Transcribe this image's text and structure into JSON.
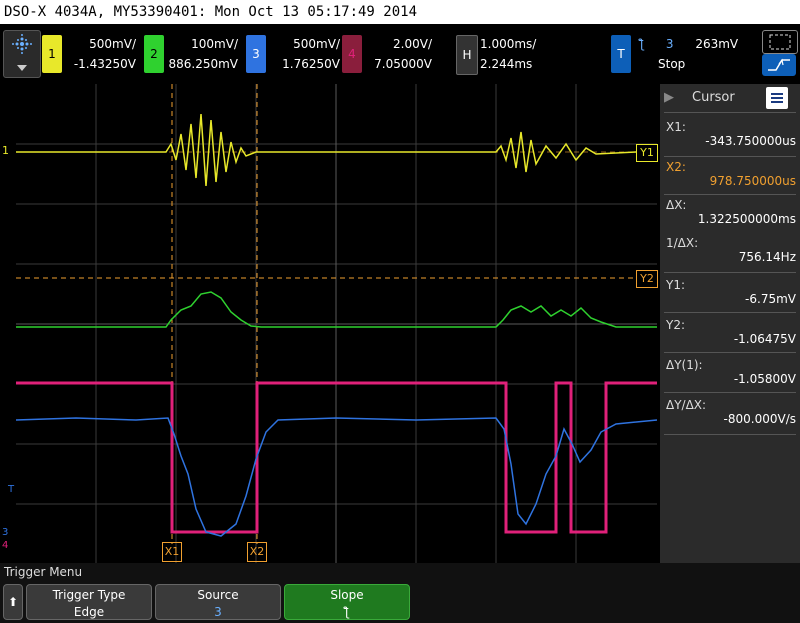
{
  "title": "DSO-X 4034A, MY53390401: Mon Oct 13 05:17:49 2014",
  "colors": {
    "ch1": "#e8e82a",
    "ch2": "#2fd12f",
    "ch3": "#2f73e0",
    "ch4": "#e0217a",
    "cursor": "#f0a030",
    "grid": "#444444"
  },
  "channels": [
    {
      "num": "1",
      "scale": "500mV/",
      "offset": "-1.43250V"
    },
    {
      "num": "2",
      "scale": "100mV/",
      "offset": "886.250mV"
    },
    {
      "num": "3",
      "scale": "500mV/",
      "offset": "1.76250V"
    },
    {
      "num": "4",
      "scale": "2.00V/",
      "offset": "7.05000V"
    }
  ],
  "horizontal": {
    "label": "H",
    "timebase": "1.000ms/",
    "delay": "2.244ms"
  },
  "trigger": {
    "label": "T",
    "slope_icon": "ƪ",
    "source": "3",
    "level": "263mV",
    "status": "Stop"
  },
  "cursor_panel": {
    "title": "Cursor",
    "rows": [
      {
        "label": "X1:",
        "value": "-343.750000us"
      },
      {
        "label": "X2:",
        "value": "978.750000us"
      },
      {
        "label": "ΔX:",
        "value": "1.322500000ms"
      },
      {
        "label": "1/ΔX:",
        "value": "756.14Hz"
      },
      {
        "label": "Y1:",
        "value": "-6.75mV"
      },
      {
        "label": "Y2:",
        "value": "-1.06475V"
      },
      {
        "label": "ΔY(1):",
        "value": "-1.05800V"
      },
      {
        "label": "ΔY/ΔX:",
        "value": "-800.000V/s"
      }
    ]
  },
  "markers": {
    "x1": "X1",
    "x2": "X2",
    "y1": "Y1",
    "y2": "Y2",
    "ch1_ground": "1",
    "ch3": "T",
    "ch3_2": "3",
    "ch4": "4"
  },
  "softkeys": {
    "menu_title": "Trigger Menu",
    "keys": [
      {
        "title": "Trigger Type",
        "value": "Edge"
      },
      {
        "title": "Source",
        "value": "3"
      },
      {
        "title": "Slope",
        "value": "ƪ"
      }
    ]
  }
}
